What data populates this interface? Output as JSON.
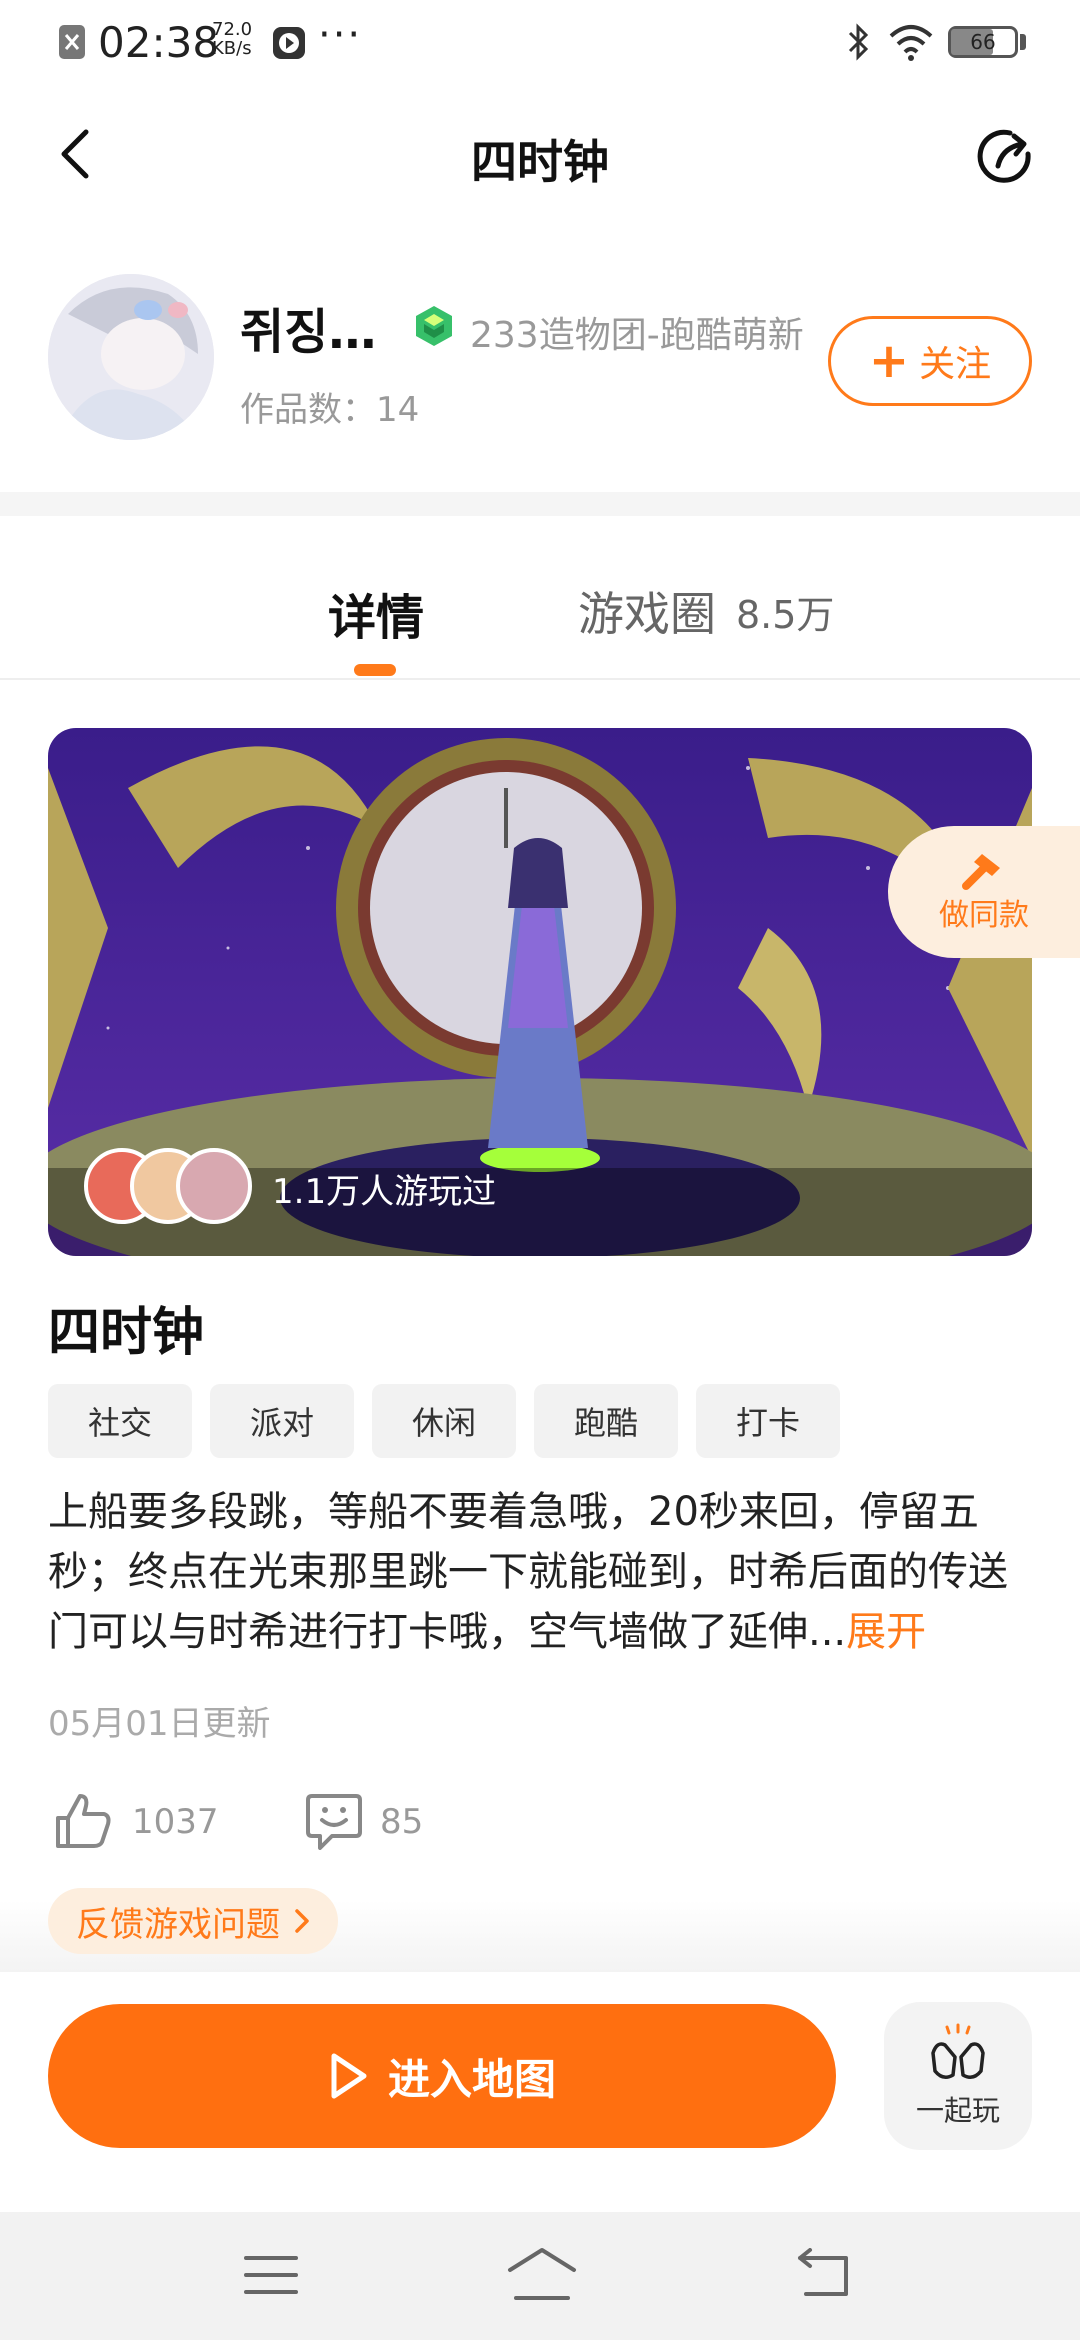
{
  "status_bar": {
    "time": "02:38",
    "speed_value": "72.0",
    "speed_unit": "KB/s",
    "more": "···",
    "battery": "66"
  },
  "header": {
    "title": "四时钟"
  },
  "author": {
    "name": "쥐징…",
    "team": "233造物团-跑酷萌新",
    "works": "作品数：14",
    "follow_label": "关注"
  },
  "tabs": {
    "detail": "详情",
    "circle": "游戏圈",
    "circle_count": "8.5万"
  },
  "hero": {
    "played": "1.1万人游玩过",
    "clone_label": "做同款"
  },
  "game": {
    "title": "四时钟",
    "tags": [
      "社交",
      "派对",
      "休闲",
      "跑酷",
      "打卡"
    ],
    "description": "上船要多段跳，等船不要着急哦，20秒来回，停留五秒；终点在光束那里跳一下就能碰到，时希后面的传送门可以与时希进行打卡哦，空气墙做了延伸...",
    "expand": "展开",
    "updated": "05月01日更新",
    "likes": "1037",
    "comments": "85",
    "feedback": "反馈游戏问题"
  },
  "actions": {
    "enter": "进入地图",
    "together": "一起玩"
  },
  "colors": {
    "accent": "#ff7a1a",
    "enter_button": "#ff6f10"
  }
}
